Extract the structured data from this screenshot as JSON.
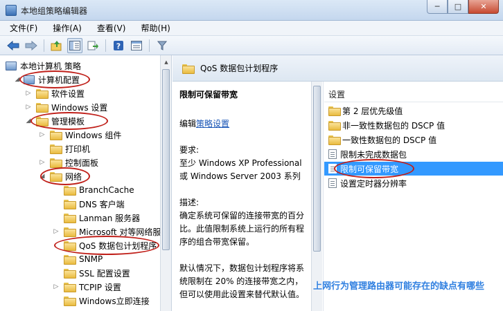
{
  "window": {
    "title": "本地组策略编辑器",
    "minimize": "─",
    "maximize": "□",
    "close": "✕"
  },
  "menu": [
    "文件(F)",
    "操作(A)",
    "查看(V)",
    "帮助(H)"
  ],
  "toolbar_icons": [
    "back-arrow-icon",
    "forward-arrow-icon",
    "up-folder-icon",
    "show-tree-icon",
    "export-icon",
    "help-icon",
    "properties-icon",
    "filter-icon"
  ],
  "tree": [
    {
      "label": "本地计算机 策略",
      "level": 0,
      "expander": "",
      "icon": "computer",
      "circled": false
    },
    {
      "label": "计算机配置",
      "level": 1,
      "expander": "◢",
      "icon": "computer",
      "circled": true
    },
    {
      "label": "软件设置",
      "level": 2,
      "expander": "▷",
      "icon": "folder",
      "circled": false
    },
    {
      "label": "Windows 设置",
      "level": 2,
      "expander": "▷",
      "icon": "folder",
      "circled": false
    },
    {
      "label": "管理模板",
      "level": 2,
      "expander": "◢",
      "icon": "folder",
      "circled": true
    },
    {
      "label": "Windows 组件",
      "level": 3,
      "expander": "▷",
      "icon": "folder",
      "circled": false
    },
    {
      "label": "打印机",
      "level": 3,
      "expander": "",
      "icon": "folder",
      "circled": false
    },
    {
      "label": "控制面板",
      "level": 3,
      "expander": "▷",
      "icon": "folder",
      "circled": false
    },
    {
      "label": "网络",
      "level": 3,
      "expander": "◢",
      "icon": "folder",
      "circled": true
    },
    {
      "label": "BranchCache",
      "level": 4,
      "expander": "",
      "icon": "folder",
      "circled": false
    },
    {
      "label": "DNS 客户端",
      "level": 4,
      "expander": "",
      "icon": "folder",
      "circled": false
    },
    {
      "label": "Lanman 服务器",
      "level": 4,
      "expander": "",
      "icon": "folder",
      "circled": false
    },
    {
      "label": "Microsoft 对等网络服",
      "level": 4,
      "expander": "▷",
      "icon": "folder",
      "circled": false
    },
    {
      "label": "QoS 数据包计划程序",
      "level": 4,
      "expander": "",
      "icon": "folder",
      "circled": true
    },
    {
      "label": "SNMP",
      "level": 4,
      "expander": "",
      "icon": "folder",
      "circled": false
    },
    {
      "label": "SSL 配置设置",
      "level": 4,
      "expander": "",
      "icon": "folder",
      "circled": false
    },
    {
      "label": "TCPIP 设置",
      "level": 4,
      "expander": "▷",
      "icon": "folder",
      "circled": false
    },
    {
      "label": "Windows立即连接",
      "level": 4,
      "expander": "",
      "icon": "folder",
      "circled": false
    }
  ],
  "header": {
    "title": "QoS 数据包计划程序"
  },
  "description": {
    "title": "限制可保留带宽",
    "edit_prefix": "编辑",
    "edit_link": "策略设置",
    "requirements_label": "要求:",
    "requirements_text": "至少 Windows XP Professional 或 Windows Server 2003 系列",
    "desc_label": "描述:",
    "desc_text": "确定系统可保留的连接带宽的百分比。此值限制系统上运行的所有程序的组合带宽保留。",
    "default_text": "默认情况下，数据包计划程序将系统限制在 20% 的连接带宽之内，但可以使用此设置来替代默认值。"
  },
  "settings": {
    "header": "设置",
    "items": [
      {
        "label": "第 2 层优先级值",
        "icon": "folder",
        "selected": false
      },
      {
        "label": "非一致性数据包的 DSCP 值",
        "icon": "folder",
        "selected": false
      },
      {
        "label": "一致性数据包的 DSCP 值",
        "icon": "folder",
        "selected": false
      },
      {
        "label": "限制未完成数据包",
        "icon": "setting",
        "selected": false
      },
      {
        "label": "限制可保留带宽",
        "icon": "setting",
        "selected": true
      },
      {
        "label": "设置定时器分辨率",
        "icon": "setting",
        "selected": false
      }
    ]
  },
  "watermark": "上网行为管理路由器可能存在的缺点有哪些",
  "colors": {
    "selection": "#3399ff",
    "annotation_circle": "#c0201a",
    "link": "#1a56b6"
  }
}
